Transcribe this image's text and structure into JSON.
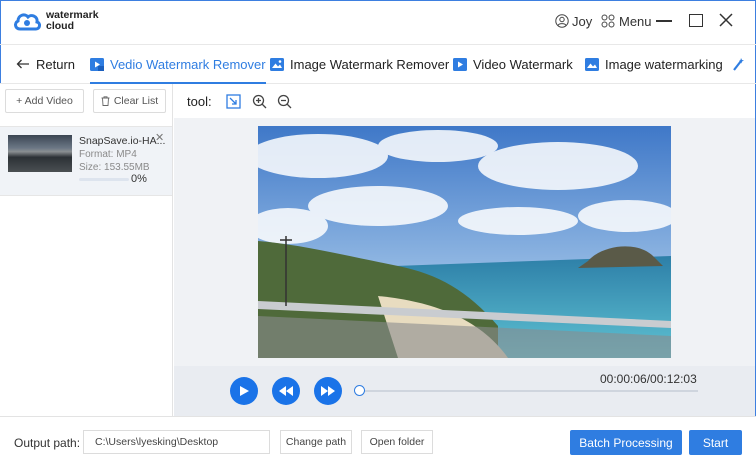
{
  "brand": {
    "line1": "watermark",
    "line2": "cloud"
  },
  "header": {
    "user": "Joy",
    "menu": "Menu"
  },
  "tabs": {
    "return": "Return",
    "items": [
      "Vedio Watermark Remover",
      "Image Watermark Remover",
      "Video Watermark",
      "Image watermarking"
    ]
  },
  "sidebar": {
    "add_video": "+ Add Video",
    "clear_list": "Clear List",
    "file": {
      "name": "SnapSave.io-HA...",
      "format": "Format:  MP4",
      "size": "Size:  153.55MB",
      "progress_text": "0%",
      "progress_value": 0
    }
  },
  "toolbar": {
    "label": "tool:"
  },
  "player": {
    "timecode": "00:00:06/00:12:03"
  },
  "bottom": {
    "output_label": "Output path:",
    "output_path": "C:\\Users\\lyesking\\Desktop",
    "change_path": "Change path",
    "open_folder": "Open folder",
    "batch": "Batch Processing",
    "start": "Start"
  },
  "colors": {
    "accent": "#2f7de1",
    "play": "#1a73e8"
  }
}
